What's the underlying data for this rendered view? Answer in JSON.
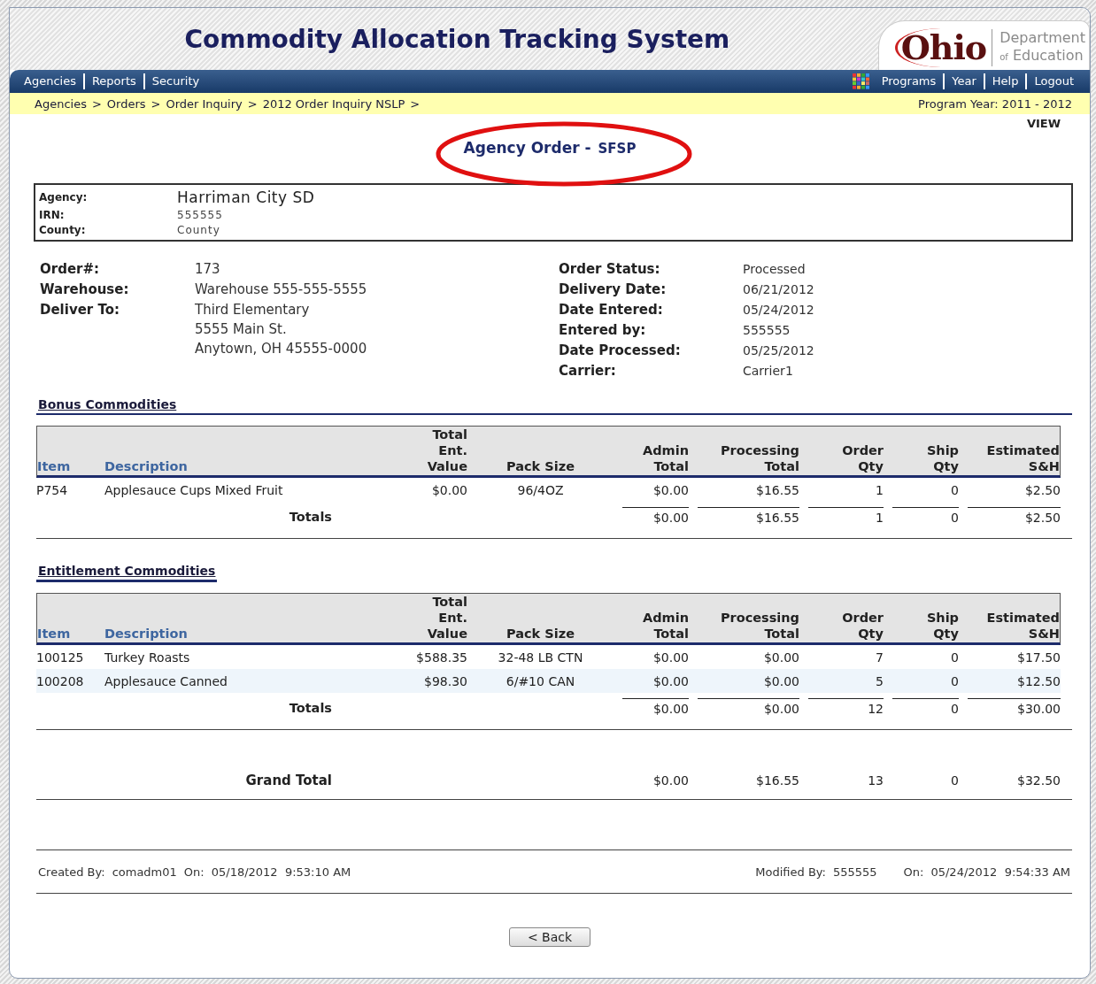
{
  "header": {
    "title": "Commodity Allocation Tracking System",
    "logo": {
      "word": "Ohio",
      "line_1": "Department",
      "line_2_small": "of",
      "line_2": "Education"
    }
  },
  "nav_left": [
    "Agencies",
    "Reports",
    "Security"
  ],
  "nav_right": [
    "Programs",
    "Year",
    "Help",
    "Logout"
  ],
  "breadcrumb": {
    "items": [
      "Agencies",
      "Orders",
      "Order Inquiry",
      "2012 Order Inquiry NSLP"
    ],
    "separator": ">"
  },
  "program_year": "Program Year: 2011 - 2012",
  "mode": "VIEW",
  "page_title": {
    "text": "Agency Order -",
    "code": "SFSP",
    "circled": true
  },
  "agency": [
    {
      "label": "Agency:",
      "value": "Harriman City SD"
    },
    {
      "label": "IRN:",
      "value": "555555"
    },
    {
      "label": "County:",
      "value": "County"
    }
  ],
  "order_left": [
    {
      "label": "Order#:",
      "lines": [
        "173"
      ]
    },
    {
      "label": "Warehouse:",
      "lines": [
        "Warehouse 555-555-5555"
      ]
    },
    {
      "label": "Deliver To:",
      "lines": [
        "Third Elementary",
        "5555 Main St.",
        "Anytown, OH 45555-0000"
      ]
    }
  ],
  "order_right": [
    {
      "label": "Order Status:",
      "value": "Processed"
    },
    {
      "label": "Delivery Date:",
      "value": "06/21/2012"
    },
    {
      "label": "Date Entered:",
      "value": "05/24/2012"
    },
    {
      "label": "Entered by:",
      "value": "555555"
    },
    {
      "label": "Date Processed:",
      "value": "05/25/2012"
    },
    {
      "label": "Carrier:",
      "value": "Carrier1"
    }
  ],
  "sections": [
    {
      "title": "Bonus Commodities",
      "full_rule": true,
      "columns": [
        "Item",
        "Description",
        "Total\nEnt.\nValue",
        "Pack Size",
        "Admin\nTotal",
        "Processing\nTotal",
        "Order\nQty",
        "Ship\nQty",
        "Estimated\nS&H"
      ],
      "rows": [
        {
          "shaded": false,
          "cells": [
            "P754",
            "Applesauce Cups Mixed Fruit",
            "$0.00",
            "96/4OZ",
            "$0.00",
            "$16.55",
            "1",
            "0",
            "$2.50"
          ]
        }
      ],
      "totals": {
        "label": "Totals",
        "values": [
          "$0.00",
          "$16.55",
          "1",
          "0",
          "$2.50"
        ]
      }
    },
    {
      "title": "Entitlement Commodities",
      "full_rule": false,
      "columns": [
        "Item",
        "Description",
        "Total\nEnt.\nValue",
        "Pack Size",
        "Admin\nTotal",
        "Processing\nTotal",
        "Order\nQty",
        "Ship\nQty",
        "Estimated\nS&H"
      ],
      "rows": [
        {
          "shaded": false,
          "cells": [
            "100125",
            "Turkey Roasts",
            "$588.35",
            "32-48 LB CTN",
            "$0.00",
            "$0.00",
            "7",
            "0",
            "$17.50"
          ]
        },
        {
          "shaded": true,
          "cells": [
            "100208",
            "Applesauce Canned",
            "$98.30",
            "6/#10 CAN",
            "$0.00",
            "$0.00",
            "5",
            "0",
            "$12.50"
          ]
        }
      ],
      "totals": {
        "label": "Totals",
        "values": [
          "$0.00",
          "$0.00",
          "12",
          "0",
          "$30.00"
        ]
      }
    }
  ],
  "grand_total": {
    "label": "Grand Total",
    "values": [
      "$0.00",
      "$16.55",
      "13",
      "0",
      "$32.50"
    ]
  },
  "audit": {
    "created_label": "Created By:",
    "created_by": "comadm01",
    "created_on_label": "On:",
    "created_on": "05/18/2012  9:53:10 AM",
    "modified_label": "Modified By:",
    "modified_by": "555555",
    "modified_on_label": "On:",
    "modified_on": "05/24/2012  9:54:33 AM"
  },
  "back_button": "< Back"
}
